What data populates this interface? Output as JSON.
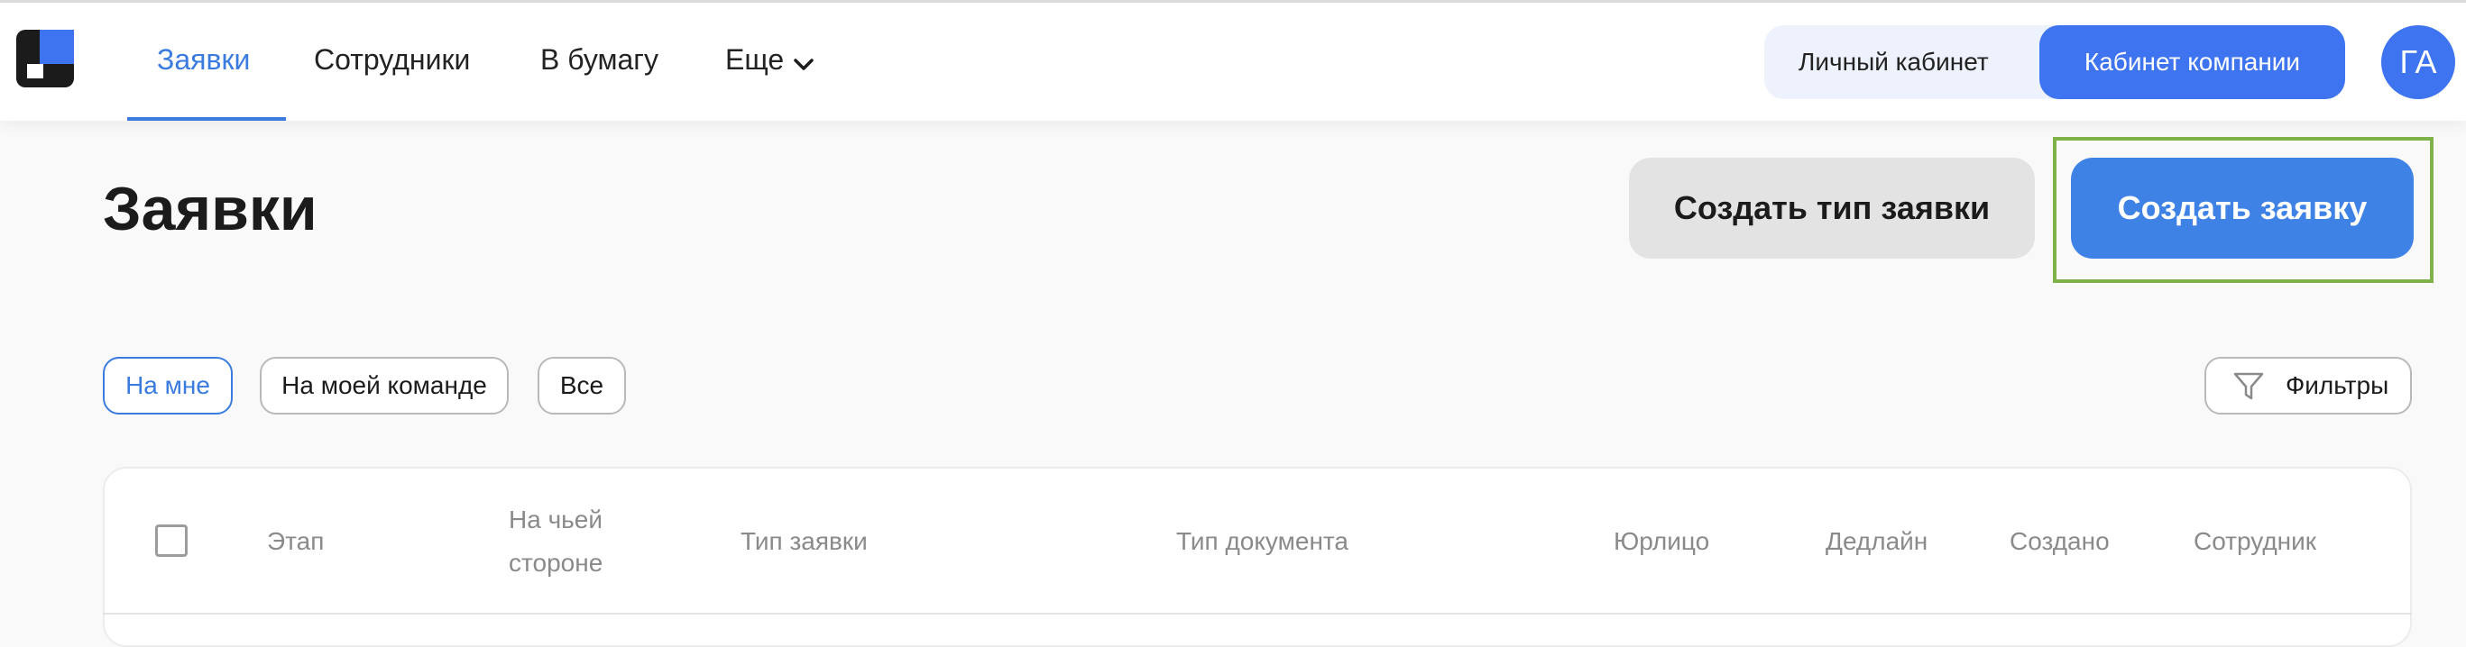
{
  "header": {
    "nav": [
      {
        "label": "Заявки",
        "active": true
      },
      {
        "label": "Сотрудники"
      },
      {
        "label": "В бумагу"
      },
      {
        "label": "Еще"
      }
    ],
    "switcher": {
      "personal": "Личный кабинет",
      "company": "Кабинет компании"
    },
    "avatar_initials": "ГА"
  },
  "page": {
    "title": "Заявки",
    "create_type_button": "Создать тип заявки",
    "create_request_button": "Создать заявку"
  },
  "filters": {
    "chips": [
      {
        "label": "На мне",
        "active": true
      },
      {
        "label": "На моей команде"
      },
      {
        "label": "Все"
      }
    ],
    "filters_button": "Фильтры"
  },
  "table": {
    "columns": [
      "Этап",
      "На чьей стороне",
      "Тип заявки",
      "Тип документа",
      "Юрлицо",
      "Дедлайн",
      "Создано",
      "Сотрудник"
    ]
  },
  "colors": {
    "accent": "#3a7be0",
    "primary_button": "#3f82e6",
    "company_tab": "#3e74f0",
    "highlight_border": "#7fb34a"
  },
  "icons": {
    "logo": "app-logo",
    "chevron": "chevron-down-icon",
    "filter": "filter-funnel-icon"
  }
}
